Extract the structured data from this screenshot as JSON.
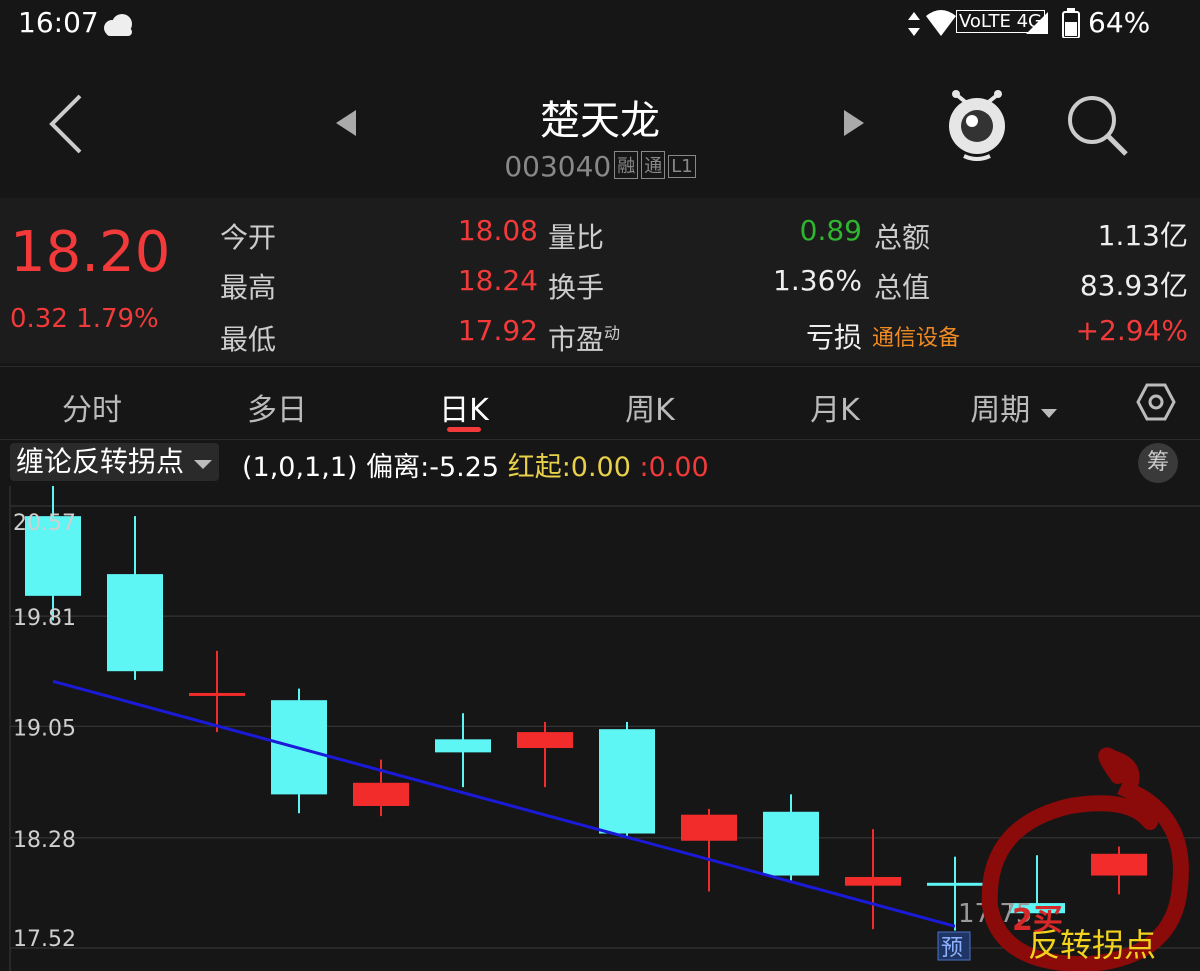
{
  "status": {
    "time": "16:07",
    "network": "VoLTE 4G",
    "battery": "64%"
  },
  "header": {
    "title": "楚天龙",
    "code": "003040",
    "tags": [
      "融",
      "通",
      "L1"
    ]
  },
  "quote": {
    "price": "18.20",
    "change": "0.32",
    "change_pct": "1.79%",
    "rows": [
      {
        "l1": "今开",
        "v1": "18.08",
        "l2": "量比",
        "v2": "0.89",
        "l3": "总额",
        "v3": "1.13亿"
      },
      {
        "l1": "最高",
        "v1": "18.24",
        "l2": "换手",
        "v2": "1.36%",
        "l3": "总值",
        "v3": "83.93亿"
      },
      {
        "l1": "最低",
        "v1": "17.92",
        "l2": "市盈",
        "l2sup": "动",
        "v2": "亏损",
        "l3": "通信设备",
        "v3": "+2.94%"
      }
    ]
  },
  "tabs": [
    "分时",
    "多日",
    "日K",
    "周K",
    "月K",
    "周期"
  ],
  "indicator": {
    "name": "缠论反转拐点",
    "params": "(1,0,1,1)",
    "deviation_label": "偏离:",
    "deviation_value": "-5.25",
    "red_start_label": "红起",
    "red_start_value": ":0.00",
    "extra_value": ":0.00",
    "chip_label": "筹"
  },
  "chart_data": {
    "type": "candlestick",
    "y_ticks": [
      "20.57",
      "19.81",
      "19.05",
      "18.28",
      "17.52"
    ],
    "ylim": [
      17.52,
      20.57
    ],
    "candles": [
      {
        "open": 20.5,
        "close": 19.95,
        "high": 20.72,
        "low": 19.78,
        "color": "cyan"
      },
      {
        "open": 20.1,
        "close": 19.43,
        "high": 20.5,
        "low": 19.37,
        "color": "cyan"
      },
      {
        "open": 19.28,
        "close": 19.28,
        "high": 19.57,
        "low": 19.01,
        "color": "red"
      },
      {
        "open": 19.23,
        "close": 18.58,
        "high": 19.31,
        "low": 18.45,
        "color": "cyan"
      },
      {
        "open": 18.5,
        "close": 18.66,
        "high": 18.82,
        "low": 18.43,
        "color": "red"
      },
      {
        "open": 18.96,
        "close": 18.87,
        "high": 19.14,
        "low": 18.63,
        "color": "cyan"
      },
      {
        "open": 18.9,
        "close": 19.01,
        "high": 19.08,
        "low": 18.63,
        "color": "red"
      },
      {
        "open": 19.03,
        "close": 18.31,
        "high": 19.08,
        "low": 18.29,
        "color": "cyan"
      },
      {
        "open": 18.26,
        "close": 18.44,
        "high": 18.48,
        "low": 17.91,
        "color": "red"
      },
      {
        "open": 18.46,
        "close": 18.02,
        "high": 18.58,
        "low": 17.97,
        "color": "cyan"
      },
      {
        "open": 17.95,
        "close": 18.01,
        "high": 18.34,
        "low": 17.65,
        "color": "red"
      },
      {
        "open": 17.97,
        "close": 17.97,
        "high": 18.15,
        "low": 17.64,
        "color": "cyan"
      },
      {
        "open": 17.83,
        "close": 17.76,
        "high": 18.16,
        "low": 17.76,
        "color": "cyan"
      },
      {
        "open": 18.02,
        "close": 18.17,
        "high": 18.22,
        "low": 17.89,
        "color": "red"
      }
    ],
    "trend_line": {
      "from": [
        0,
        19.36
      ],
      "to": [
        11,
        17.67
      ]
    },
    "annotations": {
      "last_price": "17.75",
      "buy_signal": "2买",
      "predict_tag": "预",
      "signal_label": "反转拐点"
    }
  }
}
